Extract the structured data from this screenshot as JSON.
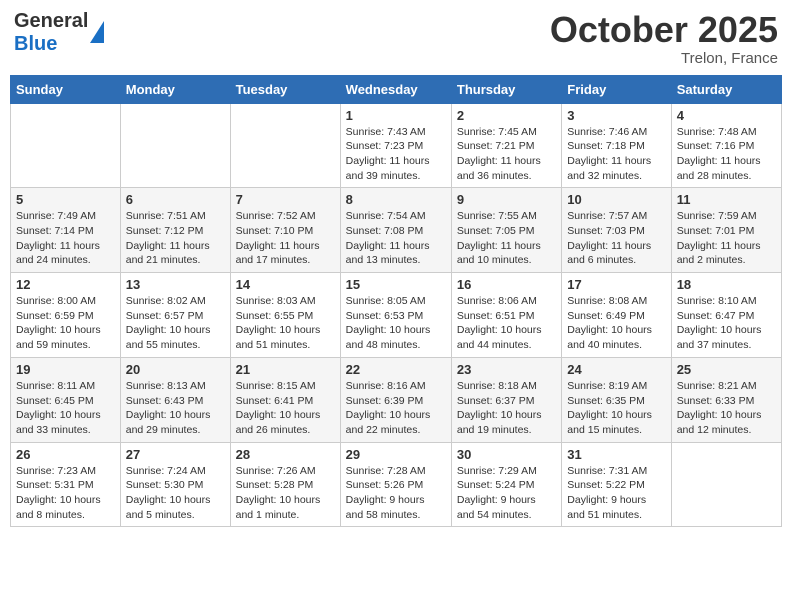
{
  "header": {
    "logo_line1": "General",
    "logo_line2": "Blue",
    "month": "October 2025",
    "location": "Trelon, France"
  },
  "days_of_week": [
    "Sunday",
    "Monday",
    "Tuesday",
    "Wednesday",
    "Thursday",
    "Friday",
    "Saturday"
  ],
  "weeks": [
    [
      {
        "day": "",
        "info": ""
      },
      {
        "day": "",
        "info": ""
      },
      {
        "day": "",
        "info": ""
      },
      {
        "day": "1",
        "info": "Sunrise: 7:43 AM\nSunset: 7:23 PM\nDaylight: 11 hours\nand 39 minutes."
      },
      {
        "day": "2",
        "info": "Sunrise: 7:45 AM\nSunset: 7:21 PM\nDaylight: 11 hours\nand 36 minutes."
      },
      {
        "day": "3",
        "info": "Sunrise: 7:46 AM\nSunset: 7:18 PM\nDaylight: 11 hours\nand 32 minutes."
      },
      {
        "day": "4",
        "info": "Sunrise: 7:48 AM\nSunset: 7:16 PM\nDaylight: 11 hours\nand 28 minutes."
      }
    ],
    [
      {
        "day": "5",
        "info": "Sunrise: 7:49 AM\nSunset: 7:14 PM\nDaylight: 11 hours\nand 24 minutes."
      },
      {
        "day": "6",
        "info": "Sunrise: 7:51 AM\nSunset: 7:12 PM\nDaylight: 11 hours\nand 21 minutes."
      },
      {
        "day": "7",
        "info": "Sunrise: 7:52 AM\nSunset: 7:10 PM\nDaylight: 11 hours\nand 17 minutes."
      },
      {
        "day": "8",
        "info": "Sunrise: 7:54 AM\nSunset: 7:08 PM\nDaylight: 11 hours\nand 13 minutes."
      },
      {
        "day": "9",
        "info": "Sunrise: 7:55 AM\nSunset: 7:05 PM\nDaylight: 11 hours\nand 10 minutes."
      },
      {
        "day": "10",
        "info": "Sunrise: 7:57 AM\nSunset: 7:03 PM\nDaylight: 11 hours\nand 6 minutes."
      },
      {
        "day": "11",
        "info": "Sunrise: 7:59 AM\nSunset: 7:01 PM\nDaylight: 11 hours\nand 2 minutes."
      }
    ],
    [
      {
        "day": "12",
        "info": "Sunrise: 8:00 AM\nSunset: 6:59 PM\nDaylight: 10 hours\nand 59 minutes."
      },
      {
        "day": "13",
        "info": "Sunrise: 8:02 AM\nSunset: 6:57 PM\nDaylight: 10 hours\nand 55 minutes."
      },
      {
        "day": "14",
        "info": "Sunrise: 8:03 AM\nSunset: 6:55 PM\nDaylight: 10 hours\nand 51 minutes."
      },
      {
        "day": "15",
        "info": "Sunrise: 8:05 AM\nSunset: 6:53 PM\nDaylight: 10 hours\nand 48 minutes."
      },
      {
        "day": "16",
        "info": "Sunrise: 8:06 AM\nSunset: 6:51 PM\nDaylight: 10 hours\nand 44 minutes."
      },
      {
        "day": "17",
        "info": "Sunrise: 8:08 AM\nSunset: 6:49 PM\nDaylight: 10 hours\nand 40 minutes."
      },
      {
        "day": "18",
        "info": "Sunrise: 8:10 AM\nSunset: 6:47 PM\nDaylight: 10 hours\nand 37 minutes."
      }
    ],
    [
      {
        "day": "19",
        "info": "Sunrise: 8:11 AM\nSunset: 6:45 PM\nDaylight: 10 hours\nand 33 minutes."
      },
      {
        "day": "20",
        "info": "Sunrise: 8:13 AM\nSunset: 6:43 PM\nDaylight: 10 hours\nand 29 minutes."
      },
      {
        "day": "21",
        "info": "Sunrise: 8:15 AM\nSunset: 6:41 PM\nDaylight: 10 hours\nand 26 minutes."
      },
      {
        "day": "22",
        "info": "Sunrise: 8:16 AM\nSunset: 6:39 PM\nDaylight: 10 hours\nand 22 minutes."
      },
      {
        "day": "23",
        "info": "Sunrise: 8:18 AM\nSunset: 6:37 PM\nDaylight: 10 hours\nand 19 minutes."
      },
      {
        "day": "24",
        "info": "Sunrise: 8:19 AM\nSunset: 6:35 PM\nDaylight: 10 hours\nand 15 minutes."
      },
      {
        "day": "25",
        "info": "Sunrise: 8:21 AM\nSunset: 6:33 PM\nDaylight: 10 hours\nand 12 minutes."
      }
    ],
    [
      {
        "day": "26",
        "info": "Sunrise: 7:23 AM\nSunset: 5:31 PM\nDaylight: 10 hours\nand 8 minutes."
      },
      {
        "day": "27",
        "info": "Sunrise: 7:24 AM\nSunset: 5:30 PM\nDaylight: 10 hours\nand 5 minutes."
      },
      {
        "day": "28",
        "info": "Sunrise: 7:26 AM\nSunset: 5:28 PM\nDaylight: 10 hours\nand 1 minute."
      },
      {
        "day": "29",
        "info": "Sunrise: 7:28 AM\nSunset: 5:26 PM\nDaylight: 9 hours\nand 58 minutes."
      },
      {
        "day": "30",
        "info": "Sunrise: 7:29 AM\nSunset: 5:24 PM\nDaylight: 9 hours\nand 54 minutes."
      },
      {
        "day": "31",
        "info": "Sunrise: 7:31 AM\nSunset: 5:22 PM\nDaylight: 9 hours\nand 51 minutes."
      },
      {
        "day": "",
        "info": ""
      }
    ]
  ]
}
